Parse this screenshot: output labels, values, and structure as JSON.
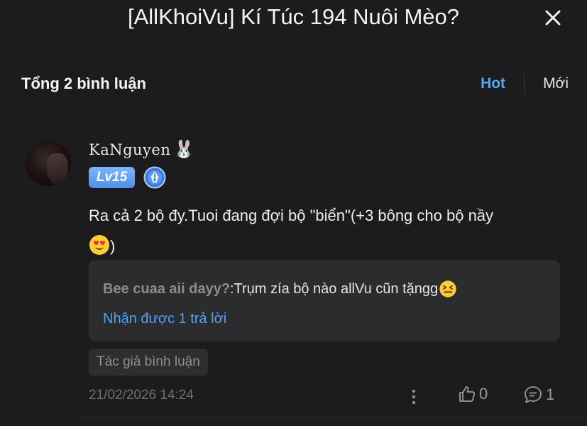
{
  "header": {
    "title": "[AllKhoiVu] Kí Túc 194 Nuôi Mèo?",
    "close_icon": "close-icon"
  },
  "comments_summary": {
    "total_label": "Tổng 2 bình luận",
    "sort_hot": "Hot",
    "sort_new": "Mới",
    "active_sort": "Hot"
  },
  "comment": {
    "username": "KaNguyen",
    "username_emoji": "🐰",
    "level_badge": "Lv15",
    "content_text": "Ra cả 2 bộ đy.Tuoi đang đợi bộ \"biển\"(+3 bông cho bộ nầy",
    "content_emoji": "heart-eyes-emoji",
    "content_end": ")",
    "reply": {
      "author": "Bee cuaa aii dayy?",
      "separator": ":",
      "text": " Trụm zía bộ nào allVu cũn tặngg",
      "emoji": "confounded-face-emoji",
      "reply_count_label": "Nhận được 1 trả lời"
    },
    "author_tag": "Tác giả bình luận",
    "date": "21/02/2026 14:24",
    "likes": "0",
    "replies": "1"
  },
  "colors": {
    "background": "#1c1c1e",
    "accent": "#58a6f6",
    "reply_box": "#2c2c2e"
  }
}
